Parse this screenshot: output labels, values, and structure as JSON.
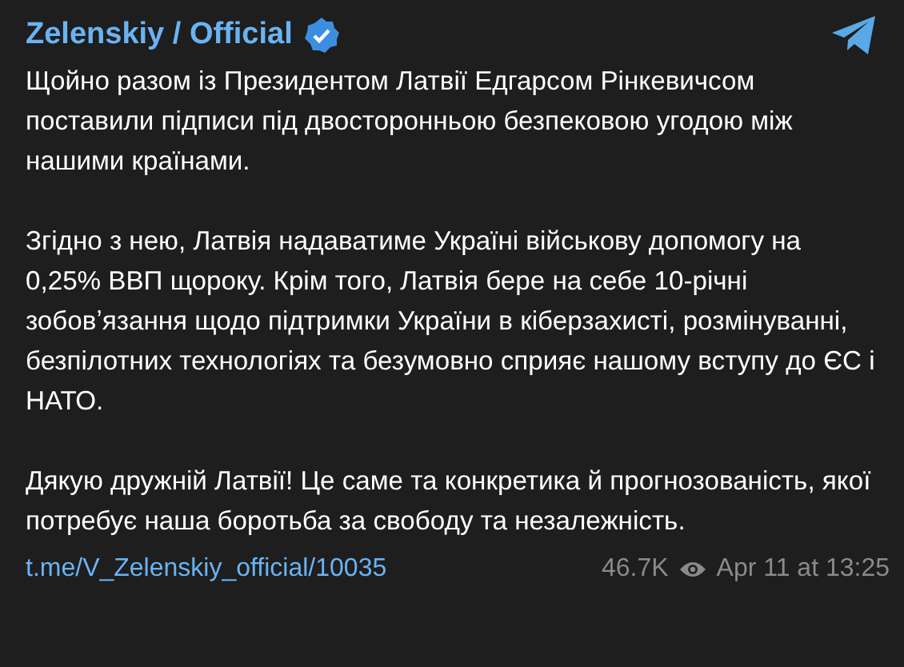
{
  "channel": {
    "name": "Zelenskiy / Official",
    "verified": true
  },
  "paragraphs": [
    "Щойно разом із Президентом Латвії Едгарсом Рінкевичсом поставили підписи під двосторонньою безпековою угодою між нашими країнами.",
    "Згідно з нею, Латвія надаватиме Україні військову допомогу на 0,25% ВВП щороку. Крім того, Латвія бере на себе 10-річні зобовʼязання щодо підтримки України в кіберзахисті, розмінуванні, безпілотних технологіях та безумовно сприяє нашому вступу до ЄС і НАТО.",
    "Дякую дружній Латвії! Це саме та конкретика й прогнозованість, якої потребує наша боротьба за свободу та незалежність."
  ],
  "footer": {
    "link": "t.me/V_Zelenskiy_official/10035",
    "views": "46.7K",
    "date": "Apr 11 at 13:25"
  }
}
